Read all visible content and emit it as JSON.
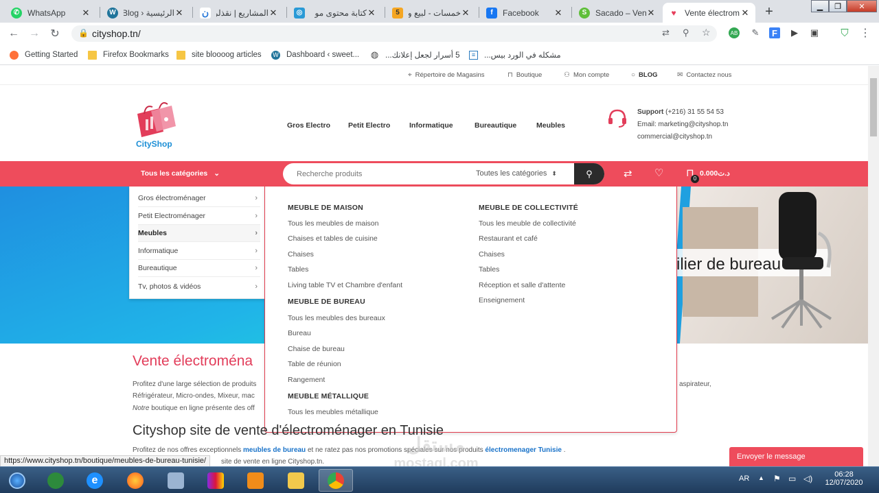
{
  "browser": {
    "tabs": [
      {
        "title": "WhatsApp",
        "icon": "whatsapp-icon",
        "color": "#25d366"
      },
      {
        "title": "الرئيسية ‹ Blog",
        "icon": "wordpress-icon",
        "color": "#21759b"
      },
      {
        "title": "المشاريع | نقذلر",
        "icon": "nafzly-icon",
        "color": "#2d7bd9"
      },
      {
        "title": "كتابة محتوى مو",
        "icon": "mostaql-icon",
        "color": "#2a9ad6"
      },
      {
        "title": "خمسات - لبيع و",
        "icon": "khamsat-icon",
        "color": "#f5a623"
      },
      {
        "title": "Facebook",
        "icon": "facebook-icon",
        "color": "#1877f2"
      },
      {
        "title": "Sacado – Vendr",
        "icon": "sacado-icon",
        "color": "#5fbf3a"
      },
      {
        "title": "Vente électrom",
        "icon": "cityshop-tab-icon",
        "color": "#e63d5a"
      }
    ],
    "url": "cityshop.tn/",
    "bookmarks": [
      {
        "label": "Getting Started",
        "icon": "firefox-icon"
      },
      {
        "label": "Firefox Bookmarks",
        "icon": "folder-icon"
      },
      {
        "label": "site bloooog articles",
        "icon": "folder-icon"
      },
      {
        "label": "Dashboard ‹ sweet...",
        "icon": "wordpress-icon"
      },
      {
        "label": "5 أسرار لجعل إعلانك...",
        "icon": "globe-icon"
      },
      {
        "label": "مشكله في الورد بيس...",
        "icon": "page-icon"
      }
    ]
  },
  "site": {
    "toplinks": [
      {
        "label": "Répertoire de Magasins",
        "icon": "map-pin-icon"
      },
      {
        "label": "Boutique",
        "icon": "bag-icon"
      },
      {
        "label": "Mon compte",
        "icon": "user-icon"
      },
      {
        "label": "BLOG",
        "icon": "chat-icon"
      },
      {
        "label": "Contactez nous",
        "icon": "mail-icon"
      }
    ],
    "logo_text": "CityShop",
    "nav": [
      "Gros Electro",
      "Petit Electro",
      "Informatique",
      "Bureautique",
      "Meubles"
    ],
    "support_label": "Support",
    "support_phone": "(+216) 31 55 54 53",
    "email_line": "Email: marketing@cityshop.tn",
    "commercial_line": "commercial@cityshop.tn",
    "all_categories": "Tous les catégories",
    "search_placeholder": "Recherche produits",
    "search_category": "Toutes les catégories",
    "cart_count": "0",
    "cart_total": "0.000د.ت",
    "categories": [
      "Gros électroménager",
      "Petit Electroménager",
      "Meubles",
      "Informatique",
      "Bureautique",
      "Tv, photos & vidéos"
    ],
    "mega": {
      "col1": [
        {
          "heading": "MEUBLE DE MAISON",
          "items": [
            "Tous les meubles de maison",
            "Chaises et tables de cuisine",
            "Chaises",
            "Tables",
            "Living table TV et Chambre d'enfant"
          ]
        },
        {
          "heading": "MEUBLE DE BUREAU",
          "items": [
            "Tous les meubles des bureaux",
            "Bureau",
            "Chaise de bureau",
            "Table de réunion",
            "Rangement"
          ]
        },
        {
          "heading": "MEUBLE MÉTALLIQUE",
          "items": [
            "Tous les meubles métallique"
          ]
        }
      ],
      "col2": [
        {
          "heading": "MEUBLE DE COLLECTIVITÉ",
          "items": [
            "Tous les meuble de collectivité",
            "Restaurant et café",
            "Chaises",
            "Tables",
            "Réception et salle d'attente",
            "Enseignement"
          ]
        }
      ]
    },
    "hero_caption": "ilier de bureau",
    "section_title": "Vente électroména",
    "para1_a": "Profitez d'une large sélection de produits",
    "para1_end": "aspirateur,",
    "para1_b": "Réfrigérateur, Micro-ondes, Mixeur, mac",
    "para1_c_italic": "Notre",
    "para1_c": " boutique en ligne présente des off",
    "section2_title": "Cityshop site de vente d'électroménager en Tunisie",
    "para2_a": "Profitez de nos offres exceptionnels ",
    "para2_link1": "meubles de bureau",
    "para2_b": " et ne ratez pas nos promotions spéciales sur nos produits ",
    "para2_link2": "électromenager Tunisie",
    "para2_c": " .",
    "para3": "site de vente en ligne Cityshop.tn.",
    "status_url": "https://www.cityshop.tn/boutique/meubles-de-bureau-tunisie/",
    "chat_label": "Envoyer le message"
  },
  "taskbar": {
    "lang": "AR",
    "time": "06:28",
    "date": "12/07/2020",
    "apps": [
      "windows-start-icon",
      "media-center-icon",
      "internet-explorer-icon",
      "firefox-icon",
      "network-computer-icon",
      "winrar-icon",
      "media-player-icon",
      "file-explorer-icon",
      "chrome-icon"
    ]
  },
  "watermark": {
    "arabic": "مستقل",
    "latin": "mostaql.com"
  },
  "colors": {
    "brand_red": "#ee4c5c",
    "dark_button": "#2b2b2b",
    "link_blue": "#1a73c9"
  }
}
